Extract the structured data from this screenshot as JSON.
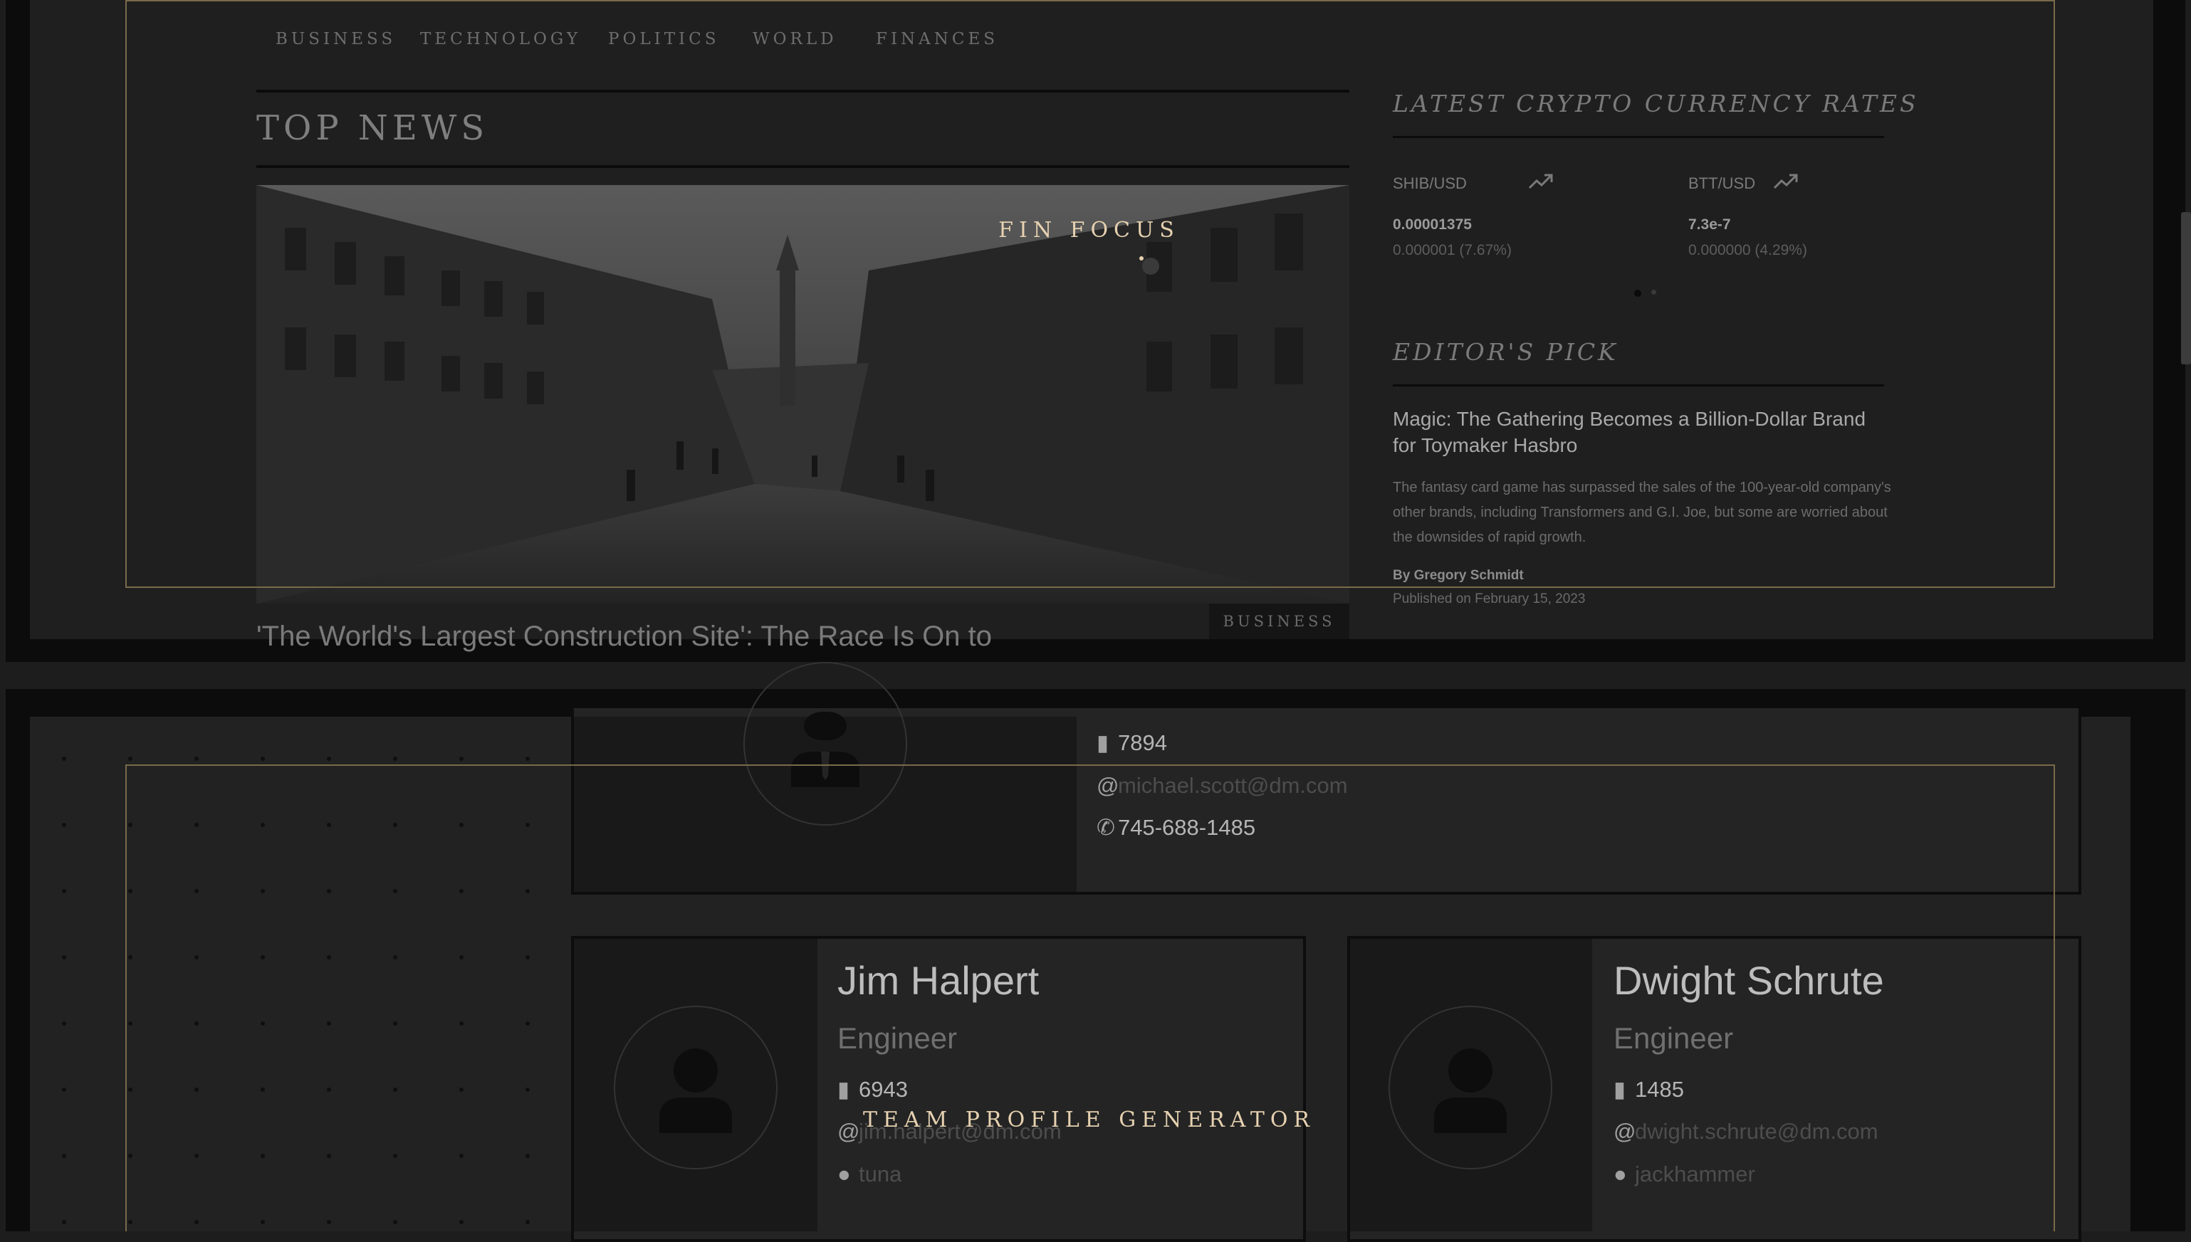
{
  "fin_focus": {
    "nav": [
      "BUSINESS",
      "TECHNOLOGY",
      "POLITICS",
      "WORLD",
      "FINANCES"
    ],
    "top_news_title": "TOP NEWS",
    "headline": "'The World's Largest Construction Site': The Race Is On to",
    "category_badge": "BUSINESS",
    "crypto_title": "LATEST CRYPTO CURRENCY RATES",
    "crypto": [
      {
        "pair": "SHIB/USD",
        "price": "0.00001375",
        "change": "0.000001 (7.67%)",
        "trend_icon": "trending-up-icon"
      },
      {
        "pair": "BTT/USD",
        "price": "7.3e-7",
        "change": "0.000000 (4.29%)",
        "trend_icon": "trending-up-icon"
      }
    ],
    "editors_pick_title": "EDITOR'S PICK",
    "pick": {
      "title": "Magic: The Gathering Becomes a Billion-Dollar Brand for Toymaker Hasbro",
      "description": "The fantasy card game has surpassed the sales of the 100-year-old company's other brands, including Transformers and G.I. Joe, but some are worried about the downsides of rapid growth.",
      "author": "By Gregory Schmidt",
      "date": "Published on February 15, 2023"
    },
    "overlay_title": "FIN FOCUS"
  },
  "team_profile": {
    "overlay_title": "TEAM PROFILE GENERATOR",
    "manager": {
      "id": "7894",
      "email": "michael.scott@dm.com",
      "phone": "745-688-1485"
    },
    "engineers": [
      {
        "name": "Jim Halpert",
        "role": "Engineer",
        "id": "6943",
        "email": "jim.halpert@dm.com",
        "github": "tuna"
      },
      {
        "name": "Dwight Schrute",
        "role": "Engineer",
        "id": "1485",
        "email": "dwight.schrute@dm.com",
        "github": "jackhammer"
      }
    ]
  },
  "colors": {
    "accent": "#e6d1b0",
    "overlay_border": "#7a6a4a",
    "background": "#1d1d1d"
  }
}
